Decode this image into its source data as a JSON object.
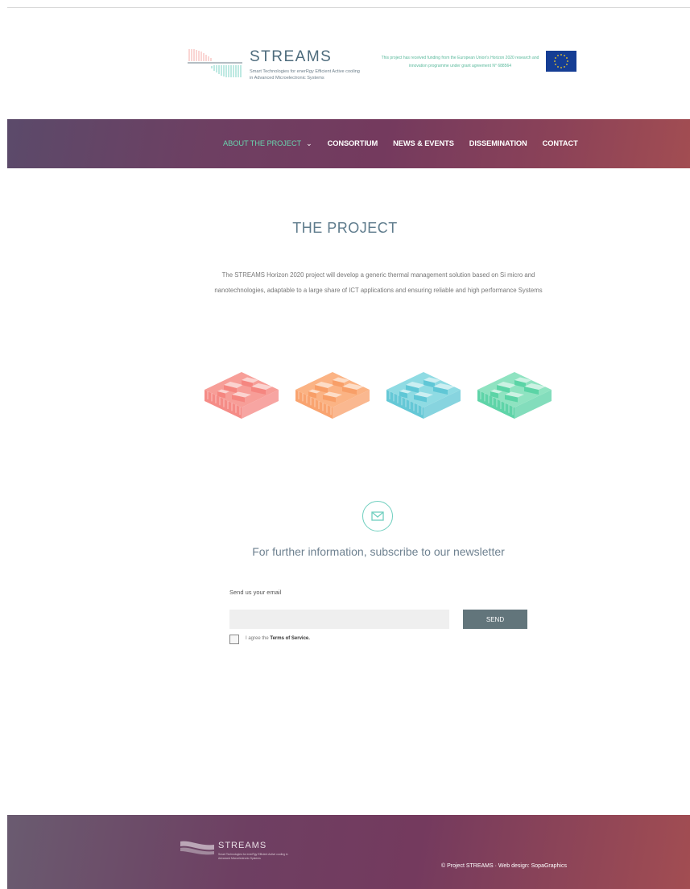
{
  "header": {
    "brand_name": "STREAMS",
    "brand_tagline": "Smart Technologies for enerRgy Efficient Active cooling in Advanced Microelectronic Systems",
    "funding_text": "This project has received funding from the European Union's Horizon 2020 research and innovation programme under grant agreement N° 688564"
  },
  "nav": {
    "items": [
      {
        "label": "ABOUT THE PROJECT"
      },
      {
        "label": "CONSORTIUM"
      },
      {
        "label": "NEWS & EVENTS"
      },
      {
        "label": "DISSEMINATION"
      },
      {
        "label": "CONTACT"
      }
    ],
    "active_index": 0
  },
  "main": {
    "title": "THE PROJECT",
    "intro": "The STREAMS Horizon 2020 project will develop a generic thermal management solution based on Si micro and nanotechnologies, adaptable to a large share of ICT applications and ensuring reliable and high performance Systems",
    "chips": [
      {
        "top": "#f79e98",
        "side": "#f47f7a"
      },
      {
        "top": "#fbb384",
        "side": "#f89a61"
      },
      {
        "top": "#8fdbe3",
        "side": "#54c2d2"
      },
      {
        "top": "#8fe3c1",
        "side": "#4ecf9f"
      }
    ]
  },
  "newsletter": {
    "heading": "For further information, subscribe to our newsletter",
    "email_label": "Send us your email",
    "email_value": "",
    "email_placeholder": "",
    "send_label": "SEND",
    "agree_prefix": "I agree the",
    "terms_label": "Terms of Service."
  },
  "footer": {
    "brand_name": "STREAMS",
    "brand_tagline": "Smart Technologies for enerRgy Efficient Active cooling in Advanced Microelectronic Systems",
    "copyright": "© Project STREAMS  ·  Web design: SopaGraphics"
  },
  "colors": {
    "accent": "#69d1ac",
    "title": "#5e7b8c",
    "send_button": "#62757b",
    "nav_gradient": [
      "#5b4a6a",
      "#743a5e",
      "#a24d52"
    ]
  },
  "icons": [
    "streams-logo-icon",
    "eu-flag-icon",
    "chevron-down-icon",
    "envelope-icon",
    "checkbox-icon"
  ]
}
